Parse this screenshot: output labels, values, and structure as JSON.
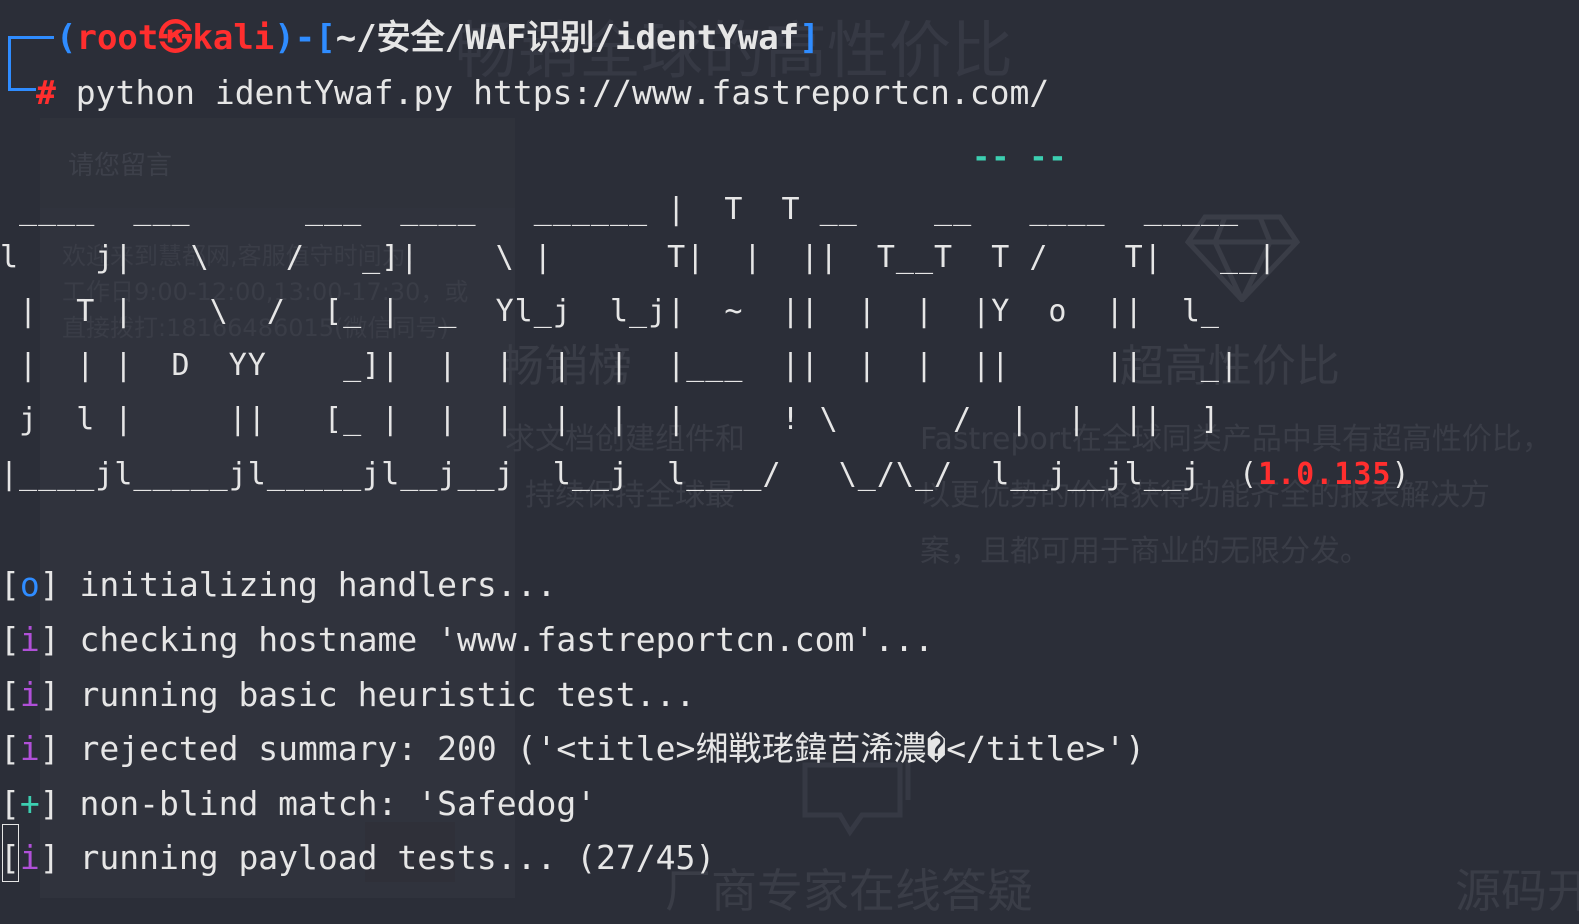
{
  "background_page": {
    "banner_text": "畅销全球的高性价比",
    "title_text": "畅销全球的高性价比",
    "panel_title": "请您留言",
    "panel_lines": [
      "欢迎来到慧都网,客服值守时间为:",
      "工作日9:00-12:00,13:00-17:30，或",
      "直接拨打:18166486015(微信同号)"
    ],
    "heading_left": "畅销榜",
    "heading_right": "超高性价比",
    "para_left": [
      "求文档创建组件和",
      "持续保持全球最"
    ],
    "para_right": [
      "Fastreport在全球同类产品中具有超高性价比，",
      "以更优势的价格获得功能齐全的报表解决方",
      "案，且都可用于商业的无限分发。"
    ],
    "footer_left": "厂商专家在线答疑",
    "footer_right": "源码开"
  },
  "terminal": {
    "prompt": {
      "user": "root",
      "at_symbol": "㉿",
      "host": "kali",
      "path": "~/安全/WAF识别/identYwaf",
      "symbol": "#",
      "command": "python identYwaf.py https://www.fastreportcn.com/"
    },
    "banner": {
      "lines": [
        "                                                   -- --",
        " ____  ___      ___  ____   ______ |  T  T __    __   ____  _____",
        "l    j|   \\    /   _]|    \\ |      T|  |  ||  T__T  T /    T|   __|",
        " |  T |    \\  /  [_ |  _  Yl_j  l_j|  ~  ||  |  |  |Y  o  ||  l_",
        " |  | |  D  YY    _]|  |  |  |  |  |___  ||  |  |  ||     ||   _|",
        " j  l |     ||   [_ |  |  |  |  |  |     ! \\      /  |  |  ||  ]",
        "|____jl_____jl_____jl__j__j  l__j  l____/   \\_/\\_/  l__j__jl__j  ("
      ],
      "version": "1.0.135"
    },
    "log": [
      {
        "tag": "o",
        "message": "initializing handlers..."
      },
      {
        "tag": "i",
        "message": "checking hostname 'www.fastreportcn.com'..."
      },
      {
        "tag": "i",
        "message": "running basic heuristic test..."
      },
      {
        "tag": "i",
        "message": "rejected summary: 200 ('<title>缃戦珯鍏苩浠濃�</title>')"
      },
      {
        "tag": "+",
        "message": "non-blind match: 'Safedog'"
      },
      {
        "tag": "i",
        "message": "running payload tests... (27/45)"
      }
    ]
  },
  "colors": {
    "background": "#2b2e38",
    "prompt_frame": "#2f8cff",
    "user_host": "#ff2e2e",
    "banner_accent": "#3ccfb1",
    "banner_orange": "#ff8f1f",
    "info_tag": "#b050d8",
    "version": "#ff2e2e"
  }
}
